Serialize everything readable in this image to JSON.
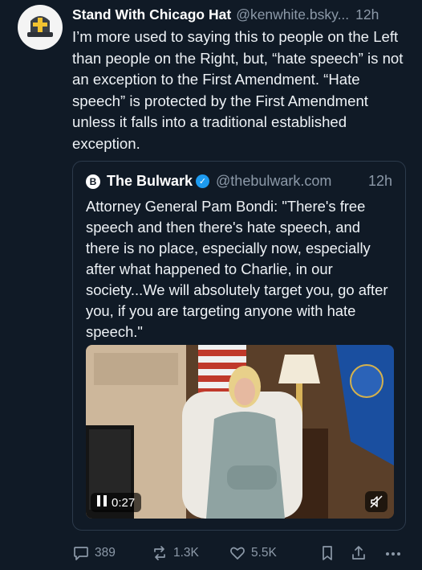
{
  "post": {
    "author_name": "Stand With Chicago Hat",
    "author_handle": "@kenwhite.bsky...",
    "time": "12h",
    "text": "I’m more used to saying this to people on the Left than people on the Right, but, “hate speech” is not an exception to the First Amendment.  “Hate speech” is protected by the First Amendment unless it falls into a traditional established exception."
  },
  "quote": {
    "author_name": "The Bulwark",
    "author_handle": "@thebulwark.com",
    "time": "12h",
    "text": "Attorney General Pam Bondi: \"There's free speech and then there's hate speech, and there is no place, especially now, especially after what happened to Charlie, in our society...We will absolutely target you, go after you, if you are targeting anyone with hate speech.\"",
    "video": {
      "duration": "0:27"
    }
  },
  "actions": {
    "replies": "389",
    "reposts": "1.3K",
    "likes": "5.5K"
  },
  "colors": {
    "background": "#101a26",
    "muted": "#8c99a8",
    "verified": "#1d9bf0"
  },
  "icons": [
    "reply-icon",
    "repost-icon",
    "like-icon",
    "bookmark-icon",
    "share-icon",
    "more-icon",
    "mute-icon",
    "verified-icon"
  ]
}
